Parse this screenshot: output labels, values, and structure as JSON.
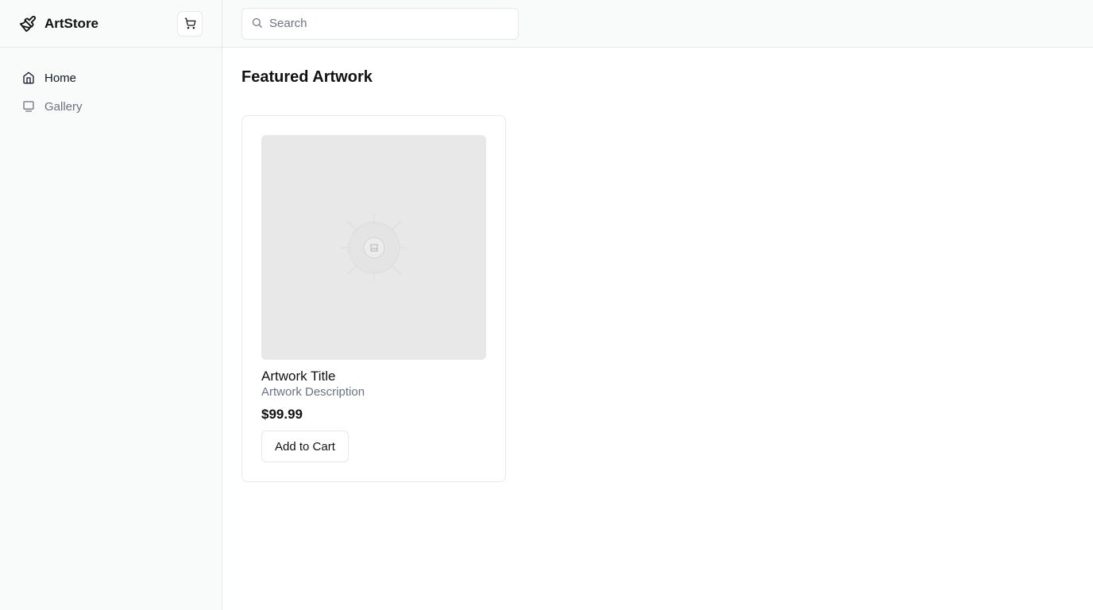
{
  "brand": {
    "name": "ArtStore",
    "icon": "paintbrush-icon"
  },
  "header": {
    "cart_icon": "cart-icon"
  },
  "sidebar": {
    "items": [
      {
        "label": "Home",
        "icon": "home-icon",
        "active": true
      },
      {
        "label": "Gallery",
        "icon": "gallery-icon",
        "active": false
      }
    ]
  },
  "search": {
    "placeholder": "Search",
    "value": ""
  },
  "main": {
    "title": "Featured Artwork",
    "card": {
      "title": "Artwork Title",
      "description": "Artwork Description",
      "price": "$99.99",
      "button_label": "Add to Cart",
      "image_icon": "image-placeholder-icon"
    }
  },
  "colors": {
    "sidebar_bg": "#f9fafa",
    "border": "#e5e7eb",
    "muted_text": "#6b7280",
    "image_placeholder": "#e8e8e8"
  }
}
